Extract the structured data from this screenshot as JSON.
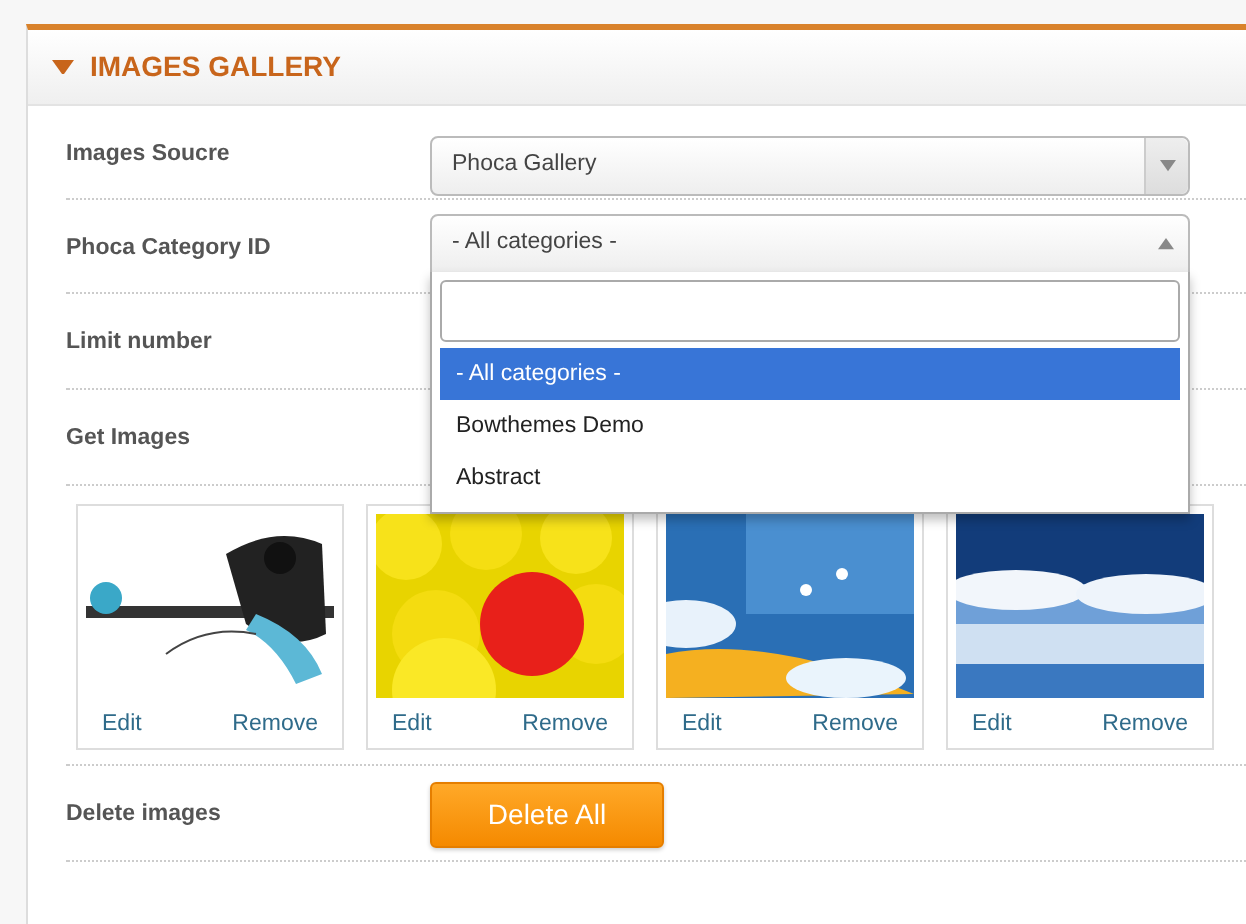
{
  "panel": {
    "title": "IMAGES GALLERY",
    "expanded": true
  },
  "fields": [
    {
      "kind": "select",
      "label": "Images Soucre",
      "value": "Phoca Gallery",
      "open": false
    },
    {
      "kind": "select",
      "label": "Phoca Category ID",
      "value": "- All categories -",
      "open": true,
      "options": [
        {
          "label": "- All categories -",
          "selected": true
        },
        {
          "label": "Bowthemes Demo",
          "selected": false
        },
        {
          "label": "Abstract",
          "selected": false
        }
      ]
    },
    {
      "kind": "plain",
      "label": "Limit number"
    },
    {
      "kind": "plain",
      "label": "Get Images"
    },
    {
      "kind": "gallery",
      "images": [
        {
          "kind": "picture",
          "edit": "Edit",
          "remove": "Remove"
        },
        {
          "kind": "picture",
          "edit": "Edit",
          "remove": "Remove"
        },
        {
          "kind": "picture",
          "edit": "Edit",
          "remove": "Remove"
        },
        {
          "kind": "picture",
          "edit": "Edit",
          "remove": "Remove"
        }
      ]
    },
    {
      "kind": "button",
      "label": "Delete images",
      "button": "Delete All"
    }
  ]
}
